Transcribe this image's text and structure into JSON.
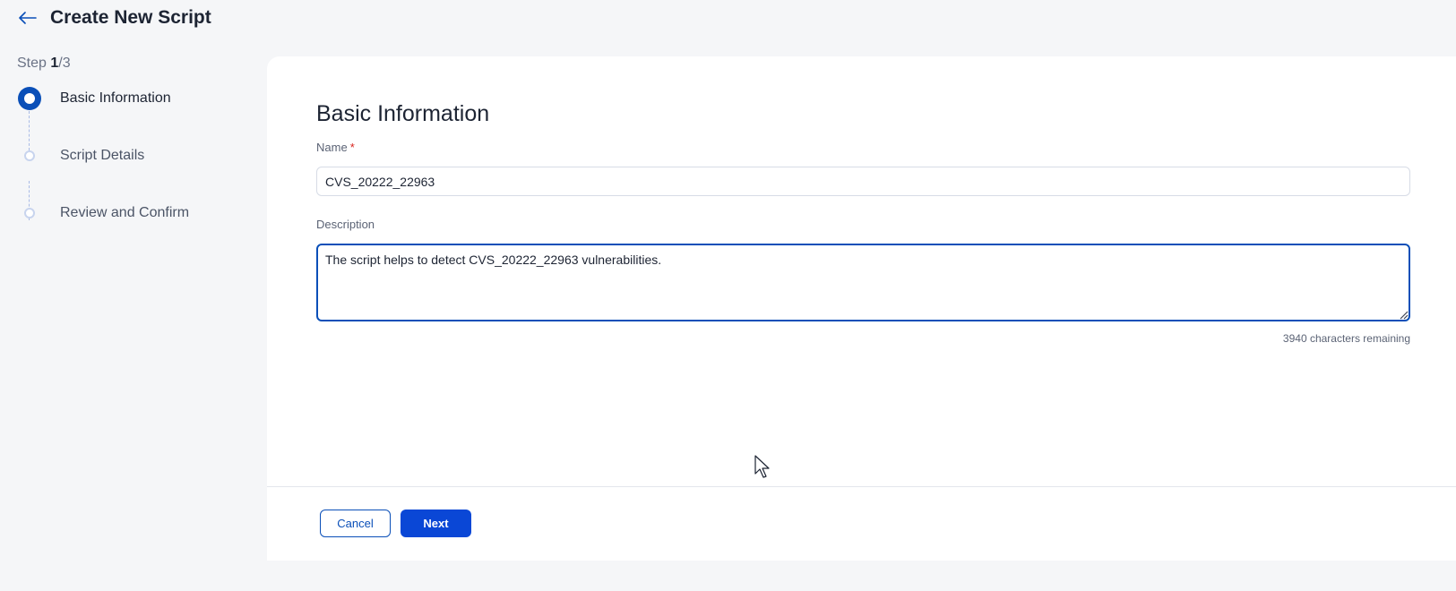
{
  "header": {
    "back_icon": "arrow-left-icon",
    "title": "Create New Script"
  },
  "stepper": {
    "step_prefix": "Step",
    "current": "1",
    "total": "/3",
    "steps": [
      {
        "label": "Basic Information",
        "state": "active"
      },
      {
        "label": "Script Details",
        "state": "pending"
      },
      {
        "label": "Review and Confirm",
        "state": "pending"
      }
    ]
  },
  "form": {
    "title": "Basic Information",
    "name_label": "Name",
    "name_required_mark": "*",
    "name_value": "CVS_20222_22963",
    "description_label": "Description",
    "description_value": "The script helps to detect CVS_20222_22963 vulnerabilities.",
    "characters_remaining": "3940 characters remaining"
  },
  "footer": {
    "cancel_label": "Cancel",
    "next_label": "Next"
  },
  "colors": {
    "primary": "#0a47d6",
    "active_step": "#0a4fb8",
    "required": "#d8221c"
  }
}
